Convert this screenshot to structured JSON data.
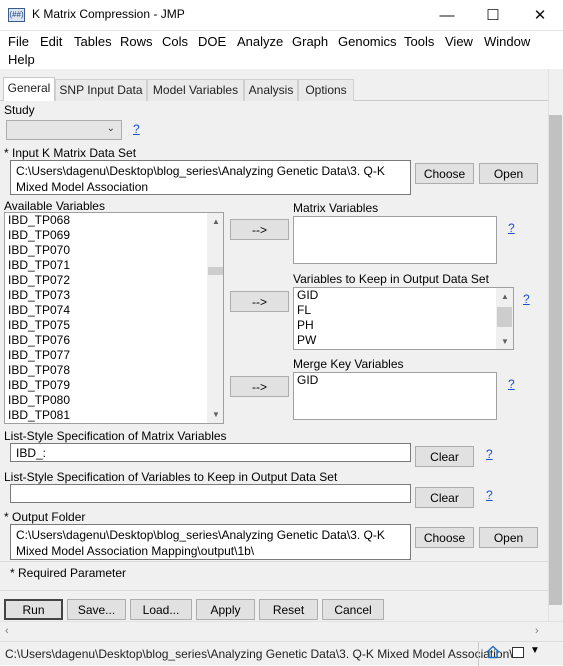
{
  "window": {
    "title": "K Matrix Compression - JMP",
    "app_icon_text": "(##)",
    "minimize": "—",
    "maximize": "☐",
    "close": "✕"
  },
  "menu": [
    "File",
    "Edit",
    "Tables",
    "Rows",
    "Cols",
    "DOE",
    "Analyze",
    "Graph",
    "Genomics",
    "Tools",
    "View",
    "Window",
    "Help"
  ],
  "tabs": [
    "General",
    "SNP Input Data",
    "Model Variables",
    "Analysis",
    "Options"
  ],
  "study": {
    "label": "Study",
    "value": "",
    "help": "?"
  },
  "input_kmatrix": {
    "label": "* Input K Matrix Data Set",
    "line1": "C:\\Users\\dagenu\\Desktop\\blog_series\\Analyzing Genetic Data\\3. Q-K",
    "line2": "Mixed Model Association",
    "choose": "Choose",
    "open": "Open"
  },
  "available": {
    "label": "Available Variables",
    "items": [
      "IBD_TP068",
      "IBD_TP069",
      "IBD_TP070",
      "IBD_TP071",
      "IBD_TP072",
      "IBD_TP073",
      "IBD_TP074",
      "IBD_TP075",
      "IBD_TP076",
      "IBD_TP077",
      "IBD_TP078",
      "IBD_TP079",
      "IBD_TP080",
      "IBD_TP081"
    ]
  },
  "move_label": "-->",
  "matrix_vars": {
    "label": "Matrix Variables",
    "items": [],
    "help": "?"
  },
  "keep_vars": {
    "label": "Variables to Keep in Output Data Set",
    "items": [
      "GID",
      "FL",
      "PH",
      "PW"
    ],
    "help": "?"
  },
  "merge_vars": {
    "label": "Merge Key Variables",
    "items": [
      "GID"
    ],
    "help": "?"
  },
  "list_matrix": {
    "label": "List-Style Specification of Matrix Variables",
    "value": "IBD_:",
    "clear": "Clear",
    "help": "?"
  },
  "list_keep": {
    "label": "List-Style Specification of Variables to Keep in Output Data Set",
    "value": "",
    "clear": "Clear",
    "help": "?"
  },
  "output_folder": {
    "label": "* Output Folder",
    "line1": "C:\\Users\\dagenu\\Desktop\\blog_series\\Analyzing Genetic Data\\3. Q-K",
    "line2": "Mixed Model Association Mapping\\output\\1b\\",
    "choose": "Choose",
    "open": "Open"
  },
  "required_note": "* Required Parameter",
  "actions": [
    "Run",
    "Save...",
    "Load...",
    "Apply",
    "Reset",
    "Cancel"
  ],
  "status": {
    "path": "C:\\Users\\dagenu\\Desktop\\blog_series\\Analyzing Genetic Data\\3. Q-K Mixed Model Association\\..."
  }
}
